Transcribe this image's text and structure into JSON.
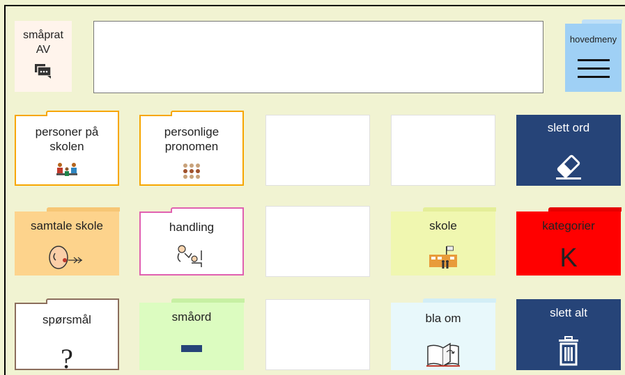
{
  "header": {
    "chat_toggle": {
      "label": "småprat\nAV",
      "icon": "chat-icon"
    },
    "message_bar": {
      "value": ""
    },
    "main_menu": {
      "label": "hovedmeny",
      "icon": "hamburger-menu-icon"
    }
  },
  "grid": {
    "row1": [
      {
        "label": "personer på\nskolen",
        "icon": "people-at-school-icon",
        "color": "#f7a600"
      },
      {
        "label": "personlige\npronomen",
        "icon": "personal-pronouns-icon",
        "color": "#f7a600"
      },
      {
        "label": ""
      },
      {
        "label": ""
      },
      {
        "label": "slett ord",
        "icon": "eraser-icon"
      }
    ],
    "row2": [
      {
        "label": "samtale skole",
        "icon": "speaking-face-icon"
      },
      {
        "label": "handling",
        "icon": "action-icon",
        "color": "#e060b0"
      },
      {
        "label": ""
      },
      {
        "label": "skole",
        "icon": "school-building-icon"
      },
      {
        "label": "kategorier",
        "letter": "K"
      }
    ],
    "row3": [
      {
        "label": "spørsmål",
        "symbol": "?"
      },
      {
        "label": "småord",
        "icon": "dash-icon"
      },
      {
        "label": ""
      },
      {
        "label": "bla om",
        "icon": "book-page-turn-icon"
      },
      {
        "label": "slett alt",
        "icon": "trash-icon"
      }
    ]
  },
  "colors": {
    "background": "#f1f3d2",
    "dark_button": "#264478",
    "categories_red": "#ff0000",
    "menu_blue": "#9fd0f5"
  }
}
